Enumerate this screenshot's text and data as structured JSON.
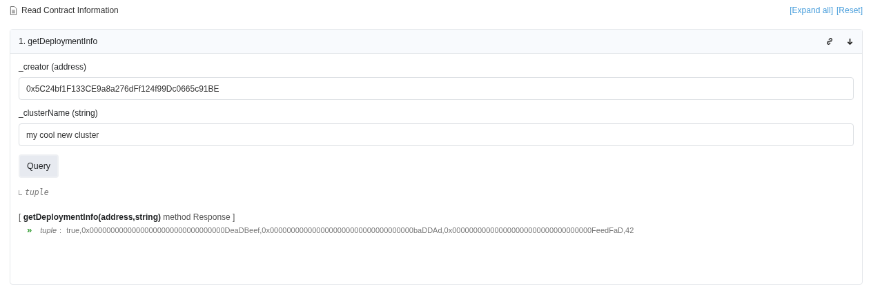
{
  "header": {
    "title": "Read Contract Information",
    "links": [
      "[Expand all]",
      "[Reset]"
    ]
  },
  "methods": [
    {
      "title": "1. getDeploymentInfo",
      "expanded": true,
      "inputs": [
        {
          "label": "_creator (address)",
          "value": "0x5C24bf1F133CE9a8a276dFf124f99Dc0665c91BE"
        },
        {
          "label": "_clusterName (string)",
          "value": "my cool new cluster"
        }
      ],
      "button": "Query",
      "output_type": "tuple",
      "response": {
        "heading": "[ **getDeploymentInfo(address,string)** method Response ]",
        "marker": "»",
        "name": "tuple",
        "separator": ":",
        "value": "true,0x00000000000000000000000000000000DeaDBeef,0x0000000000000000000000000000000000baDDAd,0x000000000000000000000000000000000FeedFaD,42"
      }
    }
  ]
}
